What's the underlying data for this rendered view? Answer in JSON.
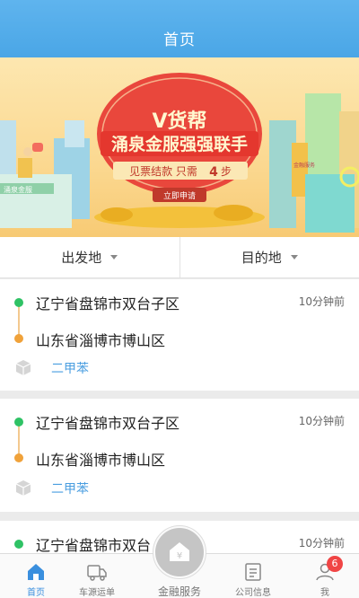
{
  "header": {
    "title": "首页"
  },
  "banner": {
    "headline": "V货帮",
    "subline": "涌泉金服强强联手",
    "tagline_prefix": "见票结款  只需",
    "tagline_number": "4",
    "tagline_suffix": "步",
    "cta": "立即申请",
    "sign_left": "涌泉金服",
    "sign_right": "金融服务"
  },
  "filter": {
    "origin_label": "出发地",
    "destination_label": "目的地"
  },
  "orders": [
    {
      "from": "辽宁省盘锦市双台子区",
      "to": "山东省淄博市博山区",
      "time": "10分钟前",
      "goods": "二甲苯"
    },
    {
      "from": "辽宁省盘锦市双台子区",
      "to": "山东省淄博市博山区",
      "time": "10分钟前",
      "goods": "二甲苯"
    },
    {
      "from": "辽宁省盘锦市双台",
      "time": "10分钟前"
    }
  ],
  "tabbar": {
    "home": "首页",
    "waybill": "车源运单",
    "finance": "金融服务",
    "company": "公司信息",
    "me": "我",
    "me_badge": "6"
  },
  "colors": {
    "header": "#4aa6e6",
    "accent": "#3a8fde",
    "green_dot": "#2fc265",
    "orange_dot": "#f0a23a",
    "badge": "#f04545"
  }
}
